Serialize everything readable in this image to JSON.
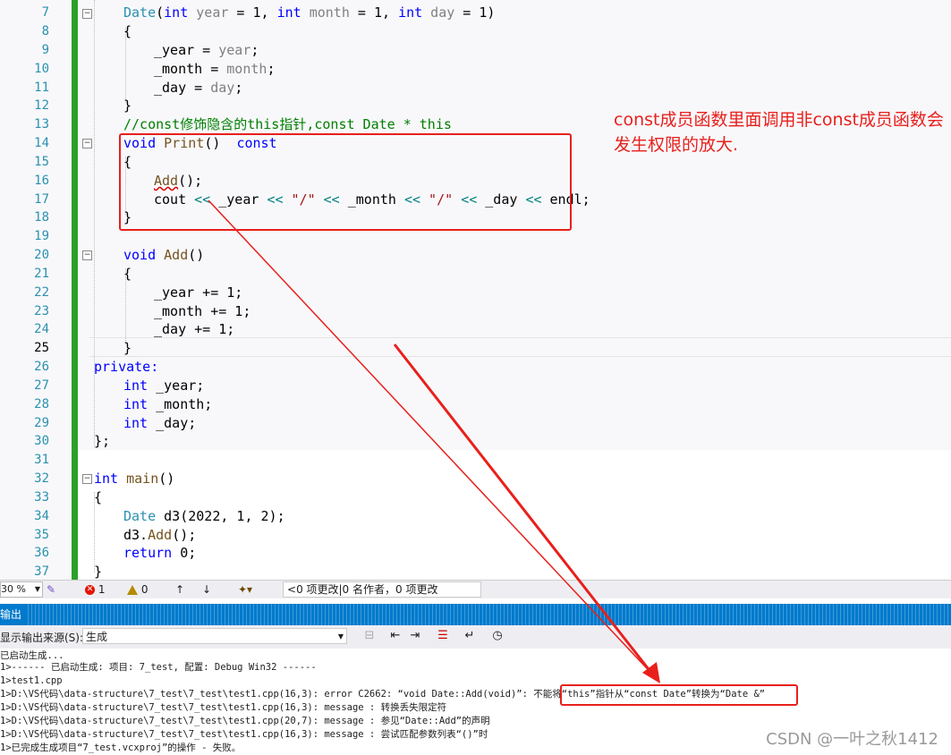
{
  "line_numbers": [
    "7",
    "8",
    "9",
    "10",
    "11",
    "12",
    "13",
    "14",
    "15",
    "16",
    "17",
    "18",
    "19",
    "20",
    "21",
    "22",
    "23",
    "24",
    "25",
    "26",
    "27",
    "28",
    "29",
    "30",
    "31",
    "32",
    "33",
    "34",
    "35",
    "36",
    "37"
  ],
  "code": {
    "l7": {
      "a": "Date",
      "b": "(",
      "c": "int",
      "d": " year",
      "e": " = 1, ",
      "f": "int",
      "g": " month",
      "h": " = 1, ",
      "i": "int",
      "j": " day",
      "k": " = 1)"
    },
    "l8": "{",
    "l9": {
      "a": "_year = ",
      "b": "year",
      "c": ";"
    },
    "l10": {
      "a": "_month = ",
      "b": "month",
      "c": ";"
    },
    "l11": {
      "a": "_day = ",
      "b": "day",
      "c": ";"
    },
    "l12": "}",
    "l13": "//const修饰隐含的this指针,const Date * this",
    "l14": {
      "a": "void",
      "b": " Print",
      "c": "()  ",
      "d": "const"
    },
    "l15": "{",
    "l16": {
      "a": "Add",
      "b": "();"
    },
    "l17": {
      "a": "cout ",
      "b": "<<",
      "c": " _year ",
      "d": "<<",
      "e": " \"/\" ",
      "f": "<<",
      "g": " _month ",
      "h": "<<",
      "i": " \"/\" ",
      "j": "<<",
      "k": " _day ",
      "l": "<<",
      "m": " endl;"
    },
    "l18": "}",
    "l20": {
      "a": "void",
      "b": " Add",
      "c": "()"
    },
    "l21": "{",
    "l22": "_year += 1;",
    "l23": "_month += 1;",
    "l24": "_day += 1;",
    "l25": "}",
    "l26": "private:",
    "l27": {
      "a": "int",
      "b": " _year;"
    },
    "l28": {
      "a": "int",
      "b": " _month;"
    },
    "l29": {
      "a": "int",
      "b": " _day;"
    },
    "l30": "};",
    "l32": {
      "a": "int",
      "b": " main",
      "c": "()"
    },
    "l33": "{",
    "l34": {
      "a": "Date",
      "b": " d3(2022, 1, 2);"
    },
    "l35": {
      "a": "d3.",
      "b": "Add",
      "c": "();"
    },
    "l36": {
      "a": "return",
      "b": " 0;"
    },
    "l37": "}"
  },
  "annotation": "const成员函数里面调用非const成员函数会发生权限的放大.",
  "statusbar": {
    "zoom": "30 %",
    "errors": "1",
    "warnings": "0",
    "changes": "0 项更改|0 名作者，0 项更改"
  },
  "output": {
    "title": "输出",
    "source_label": "显示输出来源(S):",
    "source_value": "生成",
    "lines": [
      "已启动生成...",
      "1>------ 已启动生成: 项目: 7_test, 配置: Debug Win32 ------",
      "1>test1.cpp",
      "1>D:\\VS代码\\data-structure\\7_test\\7_test\\test1.cpp(16,3): error C2662: “void Date::Add(void)”: 不能将“this”指针从“const Date”转换为“Date &”",
      "1>D:\\VS代码\\data-structure\\7_test\\7_test\\test1.cpp(16,3): message : 转换丢失限定符",
      "1>D:\\VS代码\\data-structure\\7_test\\7_test\\test1.cpp(20,7): message : 参见“Date::Add”的声明",
      "1>D:\\VS代码\\data-structure\\7_test\\7_test\\test1.cpp(16,3): message : 尝试匹配参数列表“()”时",
      "1>已完成生成项目“7_test.vcxproj”的操作 - 失败。"
    ]
  },
  "watermark": "CSDN @一叶之秋1412",
  "colors": {
    "accent": "#007acc",
    "annotation_red": "#e8201c",
    "change_bar": "#2aa02a"
  },
  "icons": [
    "lightbulb-icon",
    "error-icon",
    "warning-icon",
    "arrow-up-icon",
    "arrow-down-icon",
    "brush-icon",
    "find-icon",
    "align-left-icon",
    "align-right-icon",
    "clear-icon",
    "word-wrap-icon",
    "clock-icon"
  ]
}
